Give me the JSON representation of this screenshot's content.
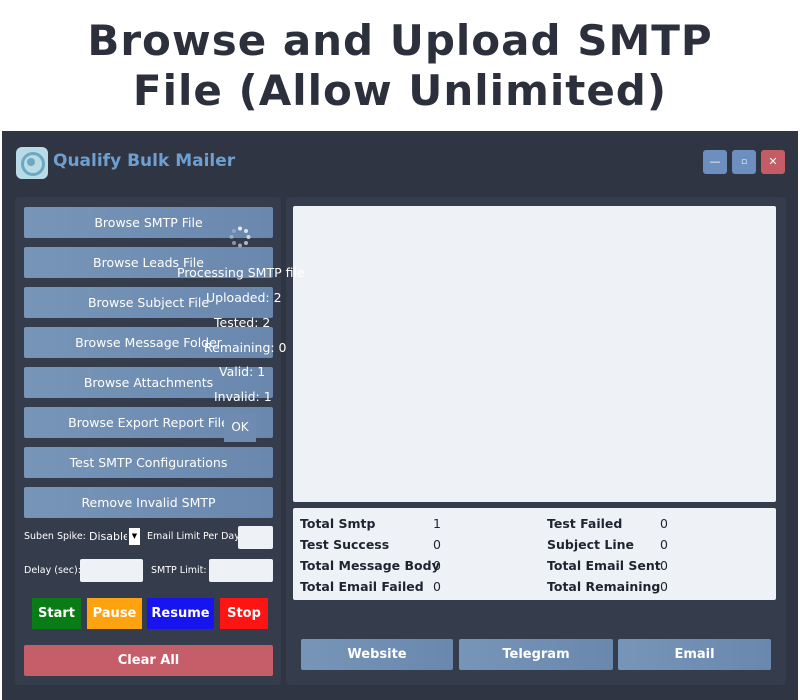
{
  "banner": {
    "line1": "Browse and Upload SMTP",
    "line2": "File (Allow Unlimited)"
  },
  "window": {
    "title": "Qualify Bulk Mailer",
    "minimize_label": "—",
    "maximize_label": "▫",
    "close_label": "✕"
  },
  "sidebar": {
    "items": [
      {
        "label": "Browse SMTP File"
      },
      {
        "label": "Browse Leads File"
      },
      {
        "label": "Browse Subject File"
      },
      {
        "label": "Browse Message Folder"
      },
      {
        "label": "Browse Attachments"
      },
      {
        "label": "Browse Export Report File"
      },
      {
        "label": "Test SMTP Configurations"
      },
      {
        "label": "Remove Invalid SMTP"
      }
    ]
  },
  "settings": {
    "suben_spike_label": "Suben Spike:",
    "suben_spike_value": "Disabled",
    "email_limit_label": "Email Limit Per Day:",
    "email_limit_value": "",
    "delay_label": "Delay (sec):",
    "delay_value": "",
    "smtp_limit_label": "SMTP Limit:",
    "smtp_limit_value": ""
  },
  "actions": {
    "start": "Start",
    "pause": "Pause",
    "resume": "Resume",
    "stop": "Stop",
    "clear_all": "Clear All"
  },
  "stats": {
    "left": [
      {
        "label": "Total Smtp",
        "value": "1"
      },
      {
        "label": "Test Success",
        "value": "0"
      },
      {
        "label": "Total Message Body",
        "value": "0"
      },
      {
        "label": "Total Email Failed",
        "value": "0"
      }
    ],
    "right": [
      {
        "label": "Test Failed",
        "value": "0"
      },
      {
        "label": "Subject Line",
        "value": "0"
      },
      {
        "label": "Total Email Sent",
        "value": "0"
      },
      {
        "label": "Total Remaining",
        "value": "0"
      }
    ]
  },
  "links": {
    "website": "Website",
    "telegram": "Telegram",
    "email": "Email"
  },
  "dialog": {
    "processing": "Processing SMTP file",
    "uploaded": "Uploaded: 2",
    "tested": "Tested: 2",
    "remaining": "Remaining: 0",
    "valid": "Valid: 1",
    "invalid": "Invalid: 1",
    "ok": "OK"
  },
  "colors": {
    "app_bg": "#2f3543",
    "panel_bg": "#353c4b",
    "button_blue": "#7090b5",
    "title_blue": "#6f9fd0",
    "clear_red": "#c65e6a",
    "start_green": "#0a7c16",
    "pause_orange": "#ffa20f",
    "resume_blue": "#1714f0",
    "stop_red": "#ff1414"
  },
  "icons": {
    "logo": "chat-bubble-logo-icon",
    "spinner": "loading-spinner-icon"
  }
}
